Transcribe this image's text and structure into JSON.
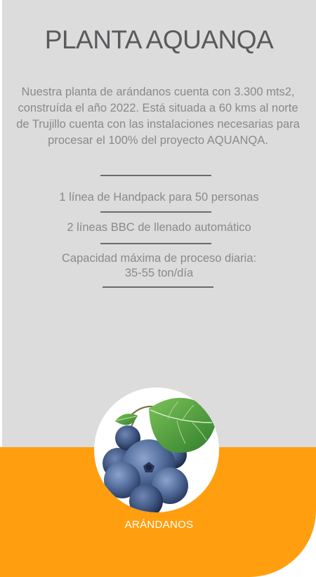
{
  "card": {
    "title": "PLANTA AQUANQA",
    "description": "Nuestra planta de arándanos cuenta con 3.300 mts2, construída el año 2022. Está situada a 60 kms al norte de Trujillo cuenta con las instalaciones necesarias para procesar el 100% del proyecto AQUANQA.",
    "features": [
      {
        "line1": "1 línea de Handpack para 50 personas"
      },
      {
        "line1": "2 líneas BBC de llenado automático"
      },
      {
        "line1": "Capacidad máxima de proceso diaria:",
        "line2": "35-55 ton/día"
      }
    ],
    "product_label": "ARÁNDANOS",
    "image_icon": "blueberries-photo",
    "colors": {
      "panel_gray": "#dcdcdd",
      "accent_orange": "#ff9f10",
      "title_text": "#5a5a5c",
      "body_text": "#8a8a8c"
    }
  }
}
